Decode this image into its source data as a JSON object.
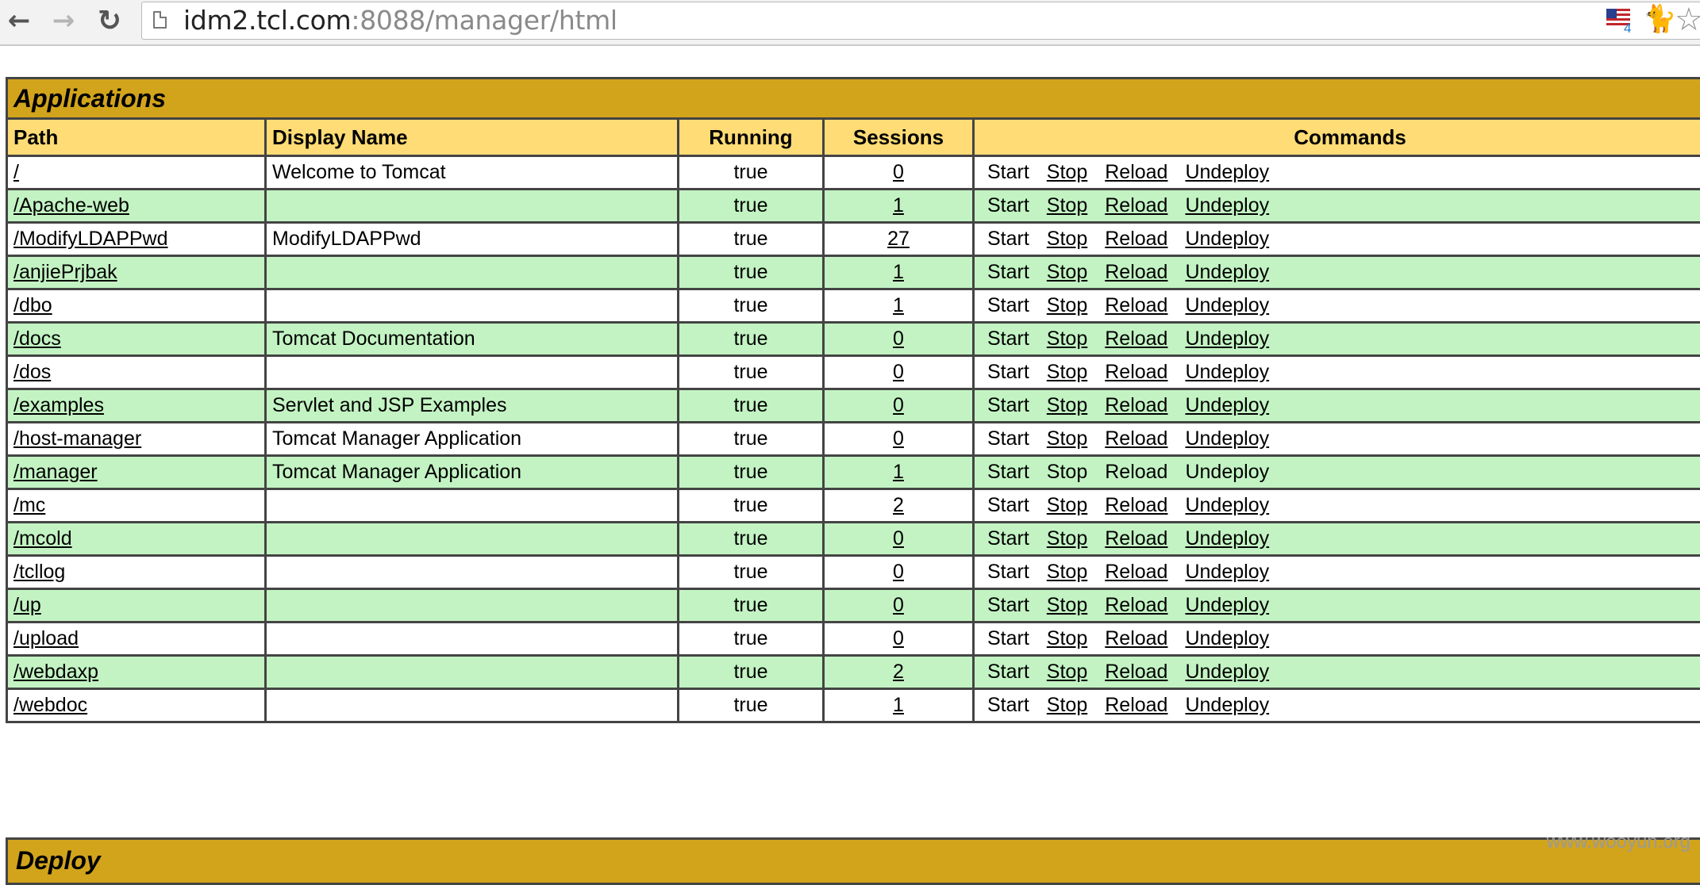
{
  "browser": {
    "url_host": "idm2.tcl.com",
    "url_rest": ":8088/manager/html",
    "ext_badge": "4"
  },
  "applications": {
    "title": "Applications",
    "headers": [
      "Path",
      "Display Name",
      "Running",
      "Sessions",
      "Commands"
    ],
    "rows": [
      {
        "path": "/",
        "display_name": "Welcome to Tomcat",
        "running": "true",
        "sessions": "0"
      },
      {
        "path": "/Apache-web",
        "display_name": "",
        "running": "true",
        "sessions": "1"
      },
      {
        "path": "/ModifyLDAPPwd",
        "display_name": "ModifyLDAPPwd",
        "running": "true",
        "sessions": "27"
      },
      {
        "path": "/anjiePrjbak",
        "display_name": "",
        "running": "true",
        "sessions": "1"
      },
      {
        "path": "/dbo",
        "display_name": "",
        "running": "true",
        "sessions": "1"
      },
      {
        "path": "/docs",
        "display_name": "Tomcat Documentation",
        "running": "true",
        "sessions": "0"
      },
      {
        "path": "/dos",
        "display_name": "",
        "running": "true",
        "sessions": "0"
      },
      {
        "path": "/examples",
        "display_name": "Servlet and JSP Examples",
        "running": "true",
        "sessions": "0"
      },
      {
        "path": "/host-manager",
        "display_name": "Tomcat Manager Application",
        "running": "true",
        "sessions": "0"
      },
      {
        "path": "/manager",
        "display_name": "Tomcat Manager Application",
        "running": "true",
        "sessions": "1",
        "commands_disabled": true
      },
      {
        "path": "/mc",
        "display_name": "",
        "running": "true",
        "sessions": "2"
      },
      {
        "path": "/mcold",
        "display_name": "",
        "running": "true",
        "sessions": "0"
      },
      {
        "path": "/tcllog",
        "display_name": "",
        "running": "true",
        "sessions": "0"
      },
      {
        "path": "/up",
        "display_name": "",
        "running": "true",
        "sessions": "0"
      },
      {
        "path": "/upload",
        "display_name": "",
        "running": "true",
        "sessions": "0"
      },
      {
        "path": "/webdaxp",
        "display_name": "",
        "running": "true",
        "sessions": "2"
      },
      {
        "path": "/webdoc",
        "display_name": "",
        "running": "true",
        "sessions": "1"
      }
    ],
    "commands": [
      "Start",
      "Stop",
      "Reload",
      "Undeploy"
    ]
  },
  "deploy": {
    "title": "Deploy"
  },
  "watermark": "www.wooyun.org",
  "colors": {
    "section_title": "#d2a41c",
    "header_row": "#ffdc75",
    "row_green": "#c3f3c3",
    "row_white": "#ffffff"
  }
}
